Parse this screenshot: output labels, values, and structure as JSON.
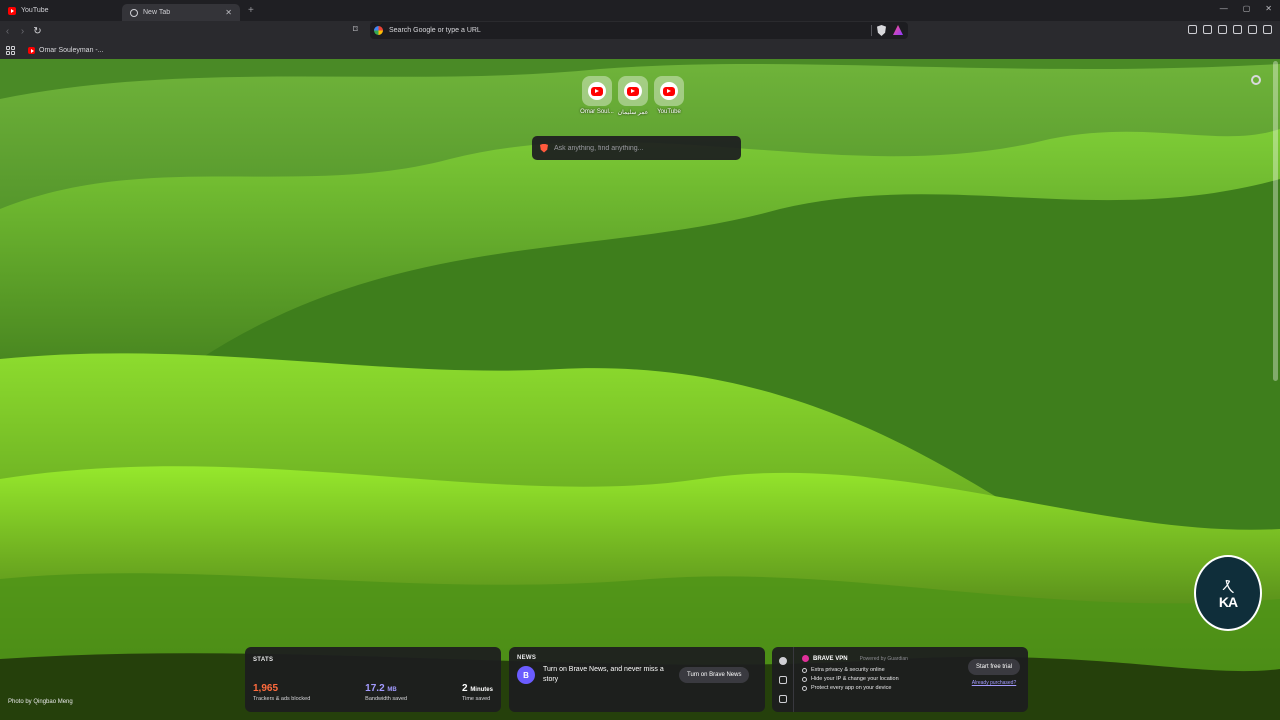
{
  "tabs": [
    {
      "title": "YouTube",
      "active": false
    },
    {
      "title": "New Tab",
      "active": true
    }
  ],
  "toolbar": {
    "url_placeholder": "Search Google or type a URL"
  },
  "bookmarks": [
    {
      "label": "Omar Souleyman -..."
    }
  ],
  "top_sites": [
    {
      "label": "Omar Soul..."
    },
    {
      "label": "عمر سليمان"
    },
    {
      "label": "YouTube"
    }
  ],
  "ask": {
    "placeholder": "Ask anything, find anything..."
  },
  "credit": "Photo by Qingbao Meng",
  "stats": {
    "title": "STATS",
    "trackers_value": "1,965",
    "trackers_label": "Trackers & ads blocked",
    "bandwidth_value": "17.2",
    "bandwidth_unit": "MB",
    "bandwidth_label": "Bandwidth saved",
    "time_value": "2",
    "time_unit": "Minutes",
    "time_label": "Time saved"
  },
  "news": {
    "title": "NEWS",
    "icon_letter": "B",
    "text": "Turn on Brave News, and never miss a story",
    "button": "Turn on Brave News"
  },
  "vpn": {
    "name": "BRAVE VPN",
    "powered": "Powered by Guardian",
    "features": [
      "Extra privacy & security online",
      "Hide your IP & change your location",
      "Protect every app on your device"
    ],
    "trial_button": "Start free trial",
    "already": "Already purchased?"
  },
  "badge": {
    "mono": "KA"
  },
  "colors": {
    "accent_red": "#ff6b3d",
    "accent_purple": "#a39bff",
    "brave_news": "#6b5cff"
  }
}
